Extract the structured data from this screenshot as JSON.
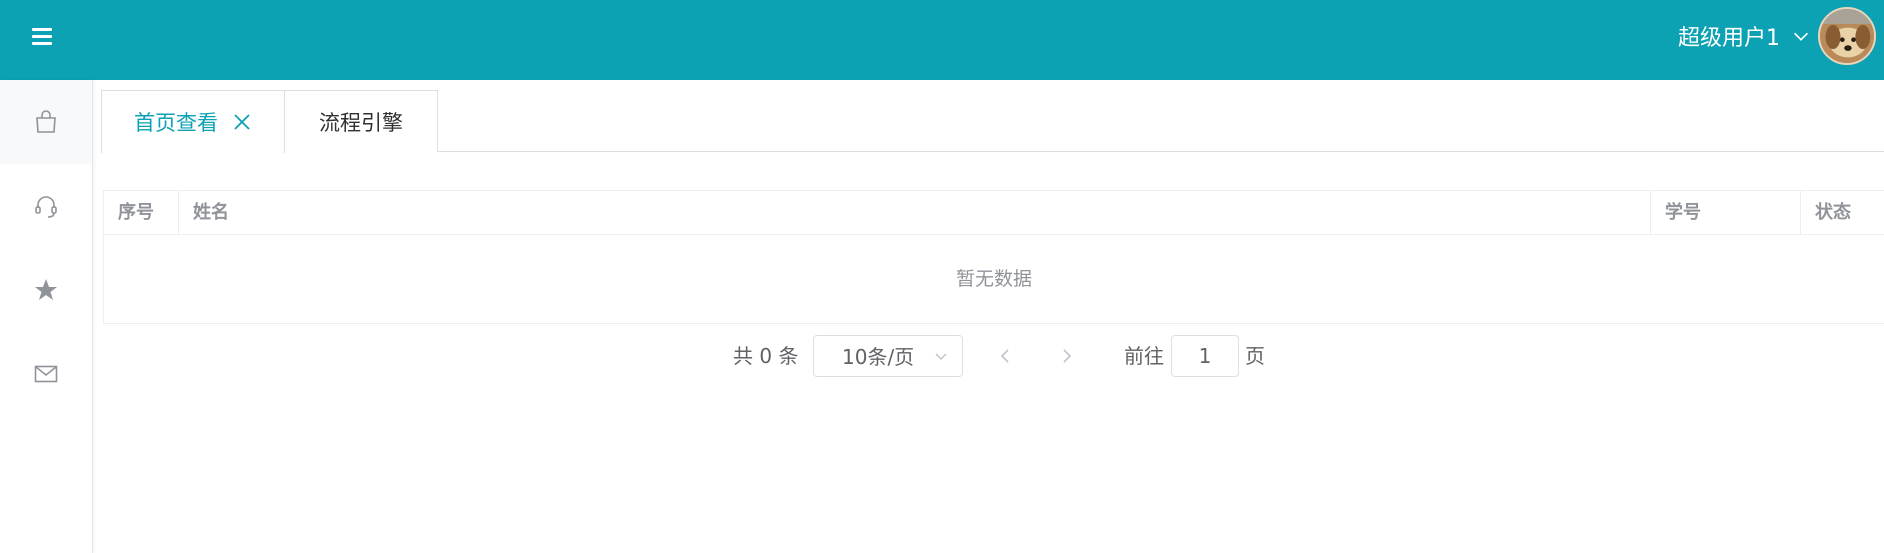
{
  "header": {
    "menu_icon": "hamburger-icon",
    "username": "超级用户1",
    "dropdown_icon": "chevron-down-icon",
    "avatar_icon": "avatar",
    "bg_color": "#0ca1b3"
  },
  "sidebar": {
    "items": [
      {
        "icon": "shopping-bag-icon",
        "active": true
      },
      {
        "icon": "headset-icon",
        "active": false
      },
      {
        "icon": "star-icon",
        "active": false
      },
      {
        "icon": "mail-icon",
        "active": false
      }
    ]
  },
  "tabs": [
    {
      "label": "首页查看",
      "active": true,
      "closable": true
    },
    {
      "label": "流程引擎",
      "active": false,
      "closable": false
    }
  ],
  "table": {
    "columns": [
      "序号",
      "姓名",
      "学号",
      "状态"
    ],
    "rows": [],
    "empty_text": "暂无数据"
  },
  "pagination": {
    "total_text": "共 0 条",
    "page_size": "10条/页",
    "goto_label": "前往",
    "current_page": "1",
    "page_suffix": "页"
  },
  "colors": {
    "accent": "#0ca1b3",
    "border": "#dcdfe6",
    "muted_text": "#909399"
  }
}
